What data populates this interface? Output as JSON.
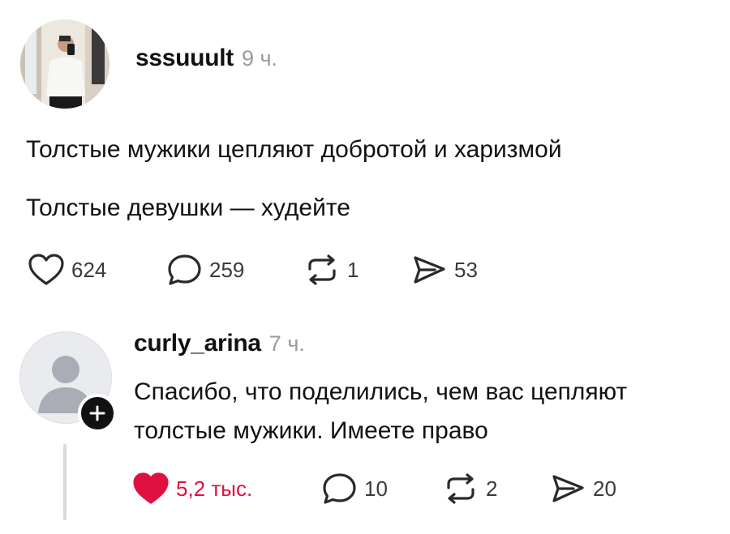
{
  "post": {
    "author": "sssuuult",
    "time": "9 ч.",
    "lines": [
      "Толстые мужики цепляют добротой и харизмой",
      "Толстые девушки — худейте"
    ],
    "stats": {
      "likes": "624",
      "comments": "259",
      "reposts": "1",
      "shares": "53"
    }
  },
  "reply": {
    "author": "curly_arina",
    "time": "7 ч.",
    "lines": [
      "Спасибо, что поделились, чем вас цепляют",
      "толстые мужики. Имеете право"
    ],
    "stats": {
      "likes": "5,2 тыс.",
      "comments": "10",
      "reposts": "2",
      "shares": "20"
    },
    "liked": true
  },
  "icons": {
    "like": "heart-icon",
    "comment": "speech-bubble-icon",
    "repost": "repost-icon",
    "share": "paper-plane-icon",
    "follow": "plus-icon"
  },
  "colors": {
    "liked_heart": "#e0103f",
    "timestamp": "#9a9a9a",
    "text": "#111111"
  }
}
